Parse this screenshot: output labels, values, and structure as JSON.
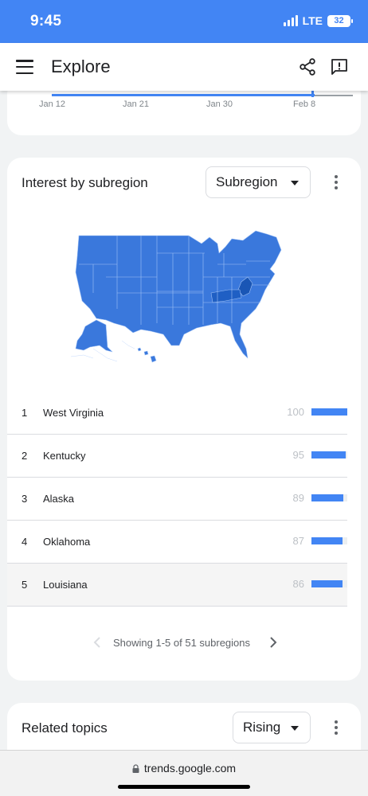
{
  "status_bar": {
    "time": "9:45",
    "network": "LTE",
    "battery": "32"
  },
  "app_bar": {
    "title": "Explore",
    "icons": [
      "menu-icon",
      "share-icon",
      "feedback-icon"
    ]
  },
  "timeline": {
    "labels": [
      "Jan 12",
      "Jan 21",
      "Jan 30",
      "Feb 8"
    ]
  },
  "subregion_card": {
    "title": "Interest by subregion",
    "dropdown": "Subregion",
    "rows": [
      {
        "rank": "1",
        "name": "West Virginia",
        "value": "100",
        "bar": 100
      },
      {
        "rank": "2",
        "name": "Kentucky",
        "value": "95",
        "bar": 95
      },
      {
        "rank": "3",
        "name": "Alaska",
        "value": "89",
        "bar": 89
      },
      {
        "rank": "4",
        "name": "Oklahoma",
        "value": "87",
        "bar": 87
      },
      {
        "rank": "5",
        "name": "Louisiana",
        "value": "86",
        "bar": 86
      }
    ],
    "pagination": "Showing 1-5 of 51 subregions"
  },
  "related_card": {
    "title": "Related topics",
    "dropdown": "Rising"
  },
  "browser": {
    "url": "trends.google.com"
  },
  "colors": {
    "accent": "#4285f4",
    "map_fill": "#3a78dc",
    "map_dark": "#1a56b5",
    "map_border": "#9fc1f5"
  }
}
